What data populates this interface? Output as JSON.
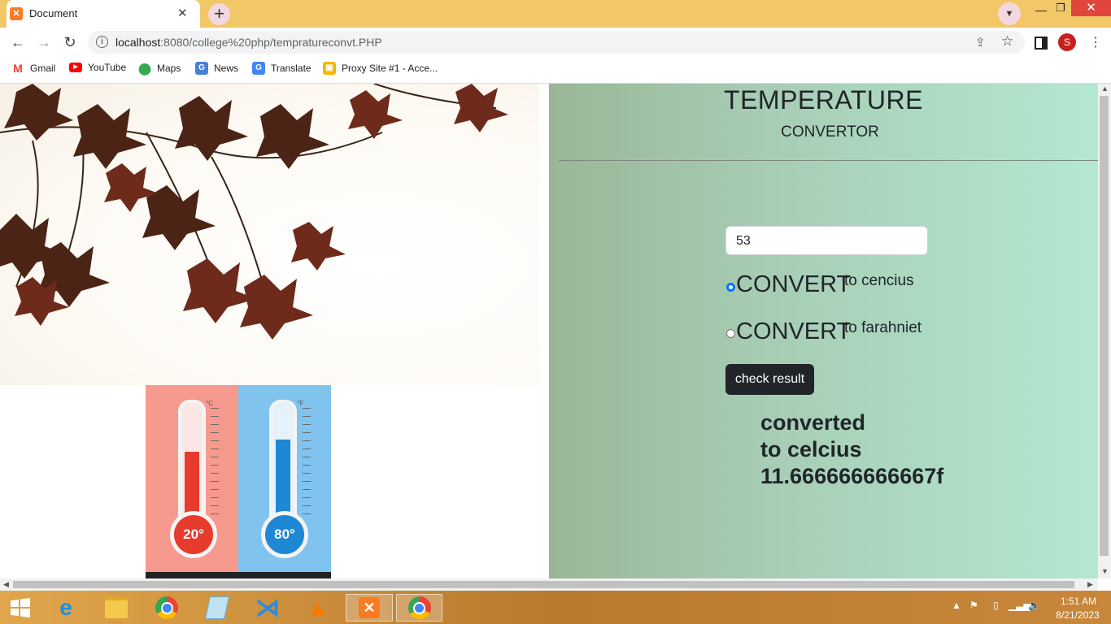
{
  "browser": {
    "tab_title": "Document",
    "new_tab_label": "+",
    "url_host": "localhost",
    "url_rest": ":8080/college%20php/tempratureconvt.PHP",
    "profile_initial": "S"
  },
  "bookmarks": [
    {
      "label": "Gmail",
      "icon": "gmail-icon"
    },
    {
      "label": "YouTube",
      "icon": "youtube-icon"
    },
    {
      "label": "Maps",
      "icon": "maps-icon"
    },
    {
      "label": "News",
      "icon": "news-icon"
    },
    {
      "label": "Translate",
      "icon": "translate-icon"
    },
    {
      "label": "Proxy Site #1 - Acce...",
      "icon": "proxy-icon"
    }
  ],
  "page": {
    "title": "TEMPERATURE",
    "subtitle": "CONVERTOR",
    "input_value": "53",
    "options": [
      {
        "word": "CONVERT",
        "suffix": "to cencius",
        "checked": true
      },
      {
        "word": "CONVERT",
        "suffix": "to farahniet",
        "checked": false
      }
    ],
    "button_label": "check result",
    "result_lines": [
      "converted",
      "to celcius",
      "11.666666666667f"
    ]
  },
  "thermometers": [
    {
      "label": "20°",
      "unit": "°C",
      "color": "#e73b2d"
    },
    {
      "label": "80°",
      "unit": "°F",
      "color": "#1e88d4"
    }
  ],
  "taskbar": {
    "time": "1:51 AM",
    "date": "8/21/2023"
  },
  "colors": {
    "tabstrip": "#f1c767",
    "panel_start": "#9ab697",
    "panel_end": "#b3e8d1",
    "button": "#212529",
    "radio_checked": "#0075ff"
  }
}
